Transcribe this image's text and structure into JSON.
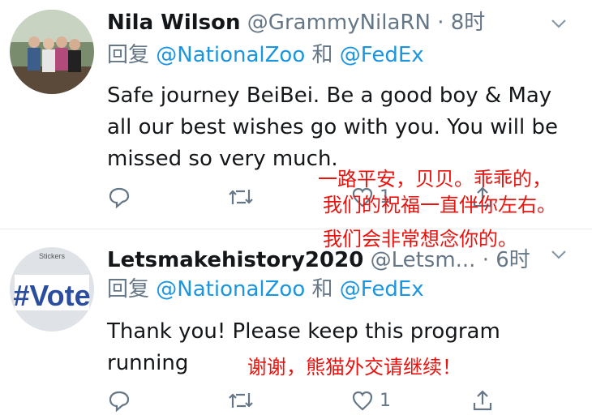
{
  "tweets": [
    {
      "name": "Nila Wilson",
      "handle": "@GrammyNilaRN",
      "dot": "·",
      "time": "8时",
      "reply_prefix": "回复",
      "mention1": "@NationalZoo",
      "conj": "和",
      "mention2": "@FedEx",
      "body": "Safe journey BeiBei. Be a good boy & May all our best wishes go with you. You will be missed so very much.",
      "like_count": "1",
      "annotation": [
        "一路平安，贝贝。乖乖的，",
        "我们的祝福一直伴你左右。",
        "我们会非常想念你的。"
      ]
    },
    {
      "name": "Letsmakehistory2020",
      "handle": "@Letsm...",
      "dot": "·",
      "time": "6时",
      "reply_prefix": "回复",
      "mention1": "@NationalZoo",
      "conj": "和",
      "mention2": "@FedEx",
      "body": "Thank you! Please keep this program running",
      "like_count": "1",
      "avatar_text": "#Vote",
      "avatar_top_text": "Stickers",
      "annotation": [
        "谢谢，熊猫外交请继续！"
      ]
    }
  ],
  "colors": {
    "link": "#1b95e0",
    "muted": "#657786",
    "annotation": "#e8130e"
  }
}
